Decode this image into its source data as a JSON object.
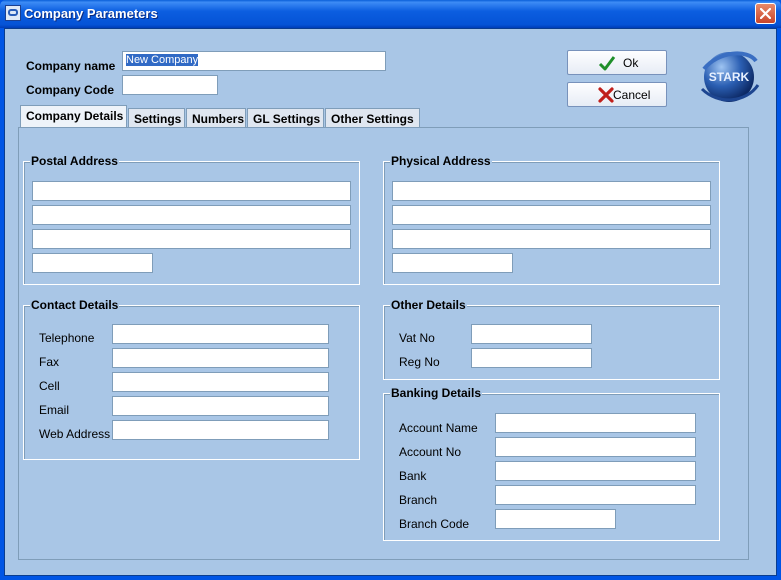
{
  "window": {
    "title": "Company Parameters"
  },
  "header": {
    "company_name_label": "Company name",
    "company_name_value": "New Company",
    "company_code_label": "Company Code",
    "company_code_value": ""
  },
  "buttons": {
    "ok": "Ok",
    "cancel": "Cancel"
  },
  "logo": {
    "text": "STARK"
  },
  "tabs": [
    {
      "label": "Company Details",
      "active": true
    },
    {
      "label": "Settings"
    },
    {
      "label": "Numbers"
    },
    {
      "label": "GL Settings"
    },
    {
      "label": "Other Settings"
    }
  ],
  "postal_address": {
    "title": "Postal Address",
    "lines": [
      "",
      "",
      "",
      ""
    ]
  },
  "physical_address": {
    "title": "Physical Address",
    "lines": [
      "",
      "",
      "",
      ""
    ]
  },
  "contact_details": {
    "title": "Contact Details",
    "fields": [
      {
        "label": "Telephone",
        "value": ""
      },
      {
        "label": "Fax",
        "value": ""
      },
      {
        "label": "Cell",
        "value": ""
      },
      {
        "label": "Email",
        "value": ""
      },
      {
        "label": "Web Address",
        "value": ""
      }
    ]
  },
  "other_details": {
    "title": "Other Details",
    "fields": [
      {
        "label": "Vat No",
        "value": ""
      },
      {
        "label": "Reg No",
        "value": ""
      }
    ]
  },
  "banking_details": {
    "title": "Banking Details",
    "fields": [
      {
        "label": "Account Name",
        "value": ""
      },
      {
        "label": "Account No",
        "value": ""
      },
      {
        "label": "Bank",
        "value": ""
      },
      {
        "label": "Branch",
        "value": ""
      },
      {
        "label": "Branch Code",
        "value": ""
      }
    ]
  },
  "colors": {
    "client_bg": "#a9c6e6",
    "titlebar": "#0553d6",
    "selection": "#316ac5"
  }
}
